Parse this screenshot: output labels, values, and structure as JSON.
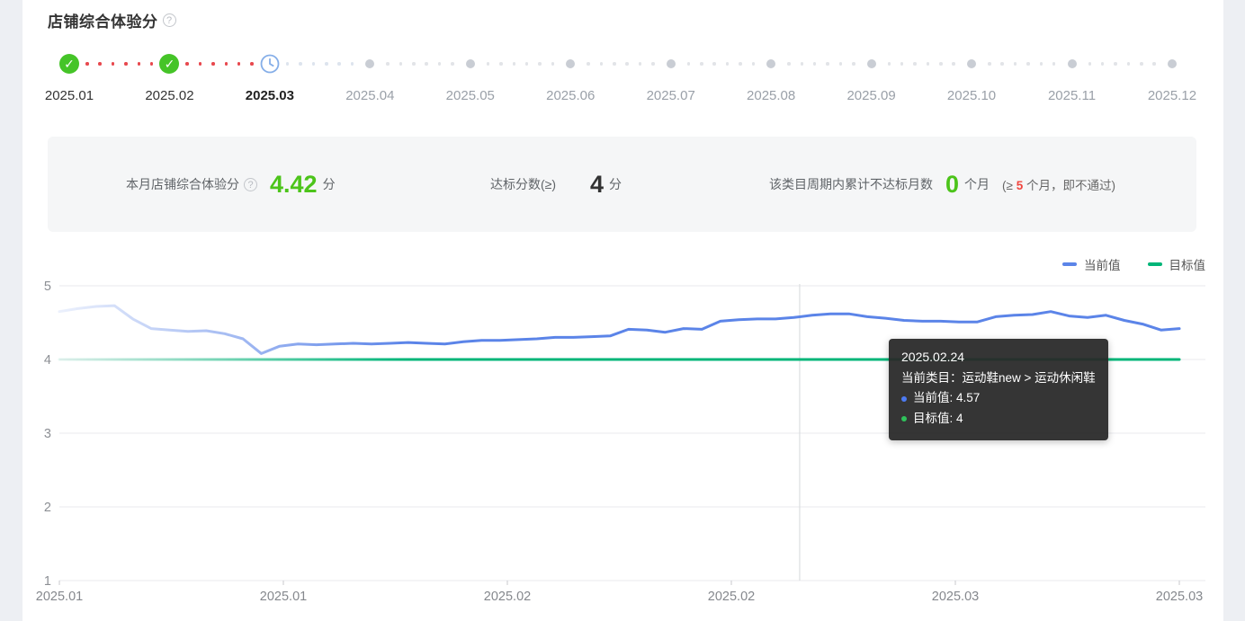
{
  "header": {
    "title": "店铺综合体验分",
    "help_icon": "question-circle-icon"
  },
  "timeline": {
    "months": [
      {
        "label": "2025.01",
        "status": "passed",
        "connector": "#e8484e"
      },
      {
        "label": "2025.02",
        "status": "passed",
        "connector": "#e8484e"
      },
      {
        "label": "2025.03",
        "status": "current",
        "connector": "#dde4ee"
      },
      {
        "label": "2025.04",
        "status": "future",
        "connector": "#e2e4e8"
      },
      {
        "label": "2025.05",
        "status": "future",
        "connector": "#e2e4e8"
      },
      {
        "label": "2025.06",
        "status": "future",
        "connector": "#e2e4e8"
      },
      {
        "label": "2025.07",
        "status": "future",
        "connector": "#e2e4e8"
      },
      {
        "label": "2025.08",
        "status": "future",
        "connector": "#e2e4e8"
      },
      {
        "label": "2025.09",
        "status": "future",
        "connector": "#e2e4e8"
      },
      {
        "label": "2025.10",
        "status": "future",
        "connector": "#e2e4e8"
      },
      {
        "label": "2025.11",
        "status": "future",
        "connector": "#e2e4e8"
      },
      {
        "label": "2025.12",
        "status": "future",
        "connector": null
      }
    ]
  },
  "summary": {
    "item1": {
      "label": "本月店铺综合体验分",
      "value": "4.42",
      "unit": "分"
    },
    "item2": {
      "label": "达标分数(≥)",
      "value": "4",
      "unit": "分"
    },
    "item3": {
      "label": "该类目周期内累计不达标月数",
      "value": "0",
      "unit": "个月",
      "note_prefix": "(≥ ",
      "note_threshold": "5",
      "note_suffix": " 个月，即不通过)"
    }
  },
  "legend": [
    {
      "label": "当前值",
      "color": "#5b84e8"
    },
    {
      "label": "目标值",
      "color": "#00b578"
    }
  ],
  "chart_data": {
    "type": "line",
    "title": "店铺综合体验分趋势",
    "ylim": [
      1,
      5
    ],
    "y_ticks": [
      1,
      2,
      3,
      4,
      5
    ],
    "x_tick_labels": [
      "2025.01",
      "2025.01",
      "2025.02",
      "2025.02",
      "2025.03",
      "2025.03"
    ],
    "grid": true,
    "legend_position": "top-right",
    "crosshair": {
      "fraction": 0.661,
      "date": "2025.02.24"
    },
    "series": [
      {
        "name": "当前值",
        "color": "#5b84e8",
        "values": [
          4.65,
          4.69,
          4.72,
          4.73,
          4.55,
          4.42,
          4.4,
          4.38,
          4.39,
          4.35,
          4.28,
          4.08,
          4.18,
          4.21,
          4.2,
          4.21,
          4.22,
          4.21,
          4.22,
          4.23,
          4.22,
          4.21,
          4.24,
          4.26,
          4.26,
          4.27,
          4.28,
          4.3,
          4.3,
          4.31,
          4.32,
          4.41,
          4.4,
          4.37,
          4.42,
          4.41,
          4.52,
          4.54,
          4.55,
          4.55,
          4.57,
          4.6,
          4.62,
          4.62,
          4.58,
          4.56,
          4.53,
          4.52,
          4.52,
          4.51,
          4.51,
          4.58,
          4.6,
          4.61,
          4.65,
          4.59,
          4.57,
          4.6,
          4.53,
          4.48,
          4.4,
          4.42
        ]
      },
      {
        "name": "目标值",
        "color": "#00b578",
        "constant": 4
      }
    ]
  },
  "tooltip": {
    "date": "2025.02.24",
    "category_label": "当前类目：运动鞋new > 运动休闲鞋",
    "rows": [
      {
        "label": "当前值",
        "value": "4.57",
        "color": "#4d7bf3"
      },
      {
        "label": "目标值",
        "value": "4",
        "color": "#2fc25b"
      }
    ]
  }
}
